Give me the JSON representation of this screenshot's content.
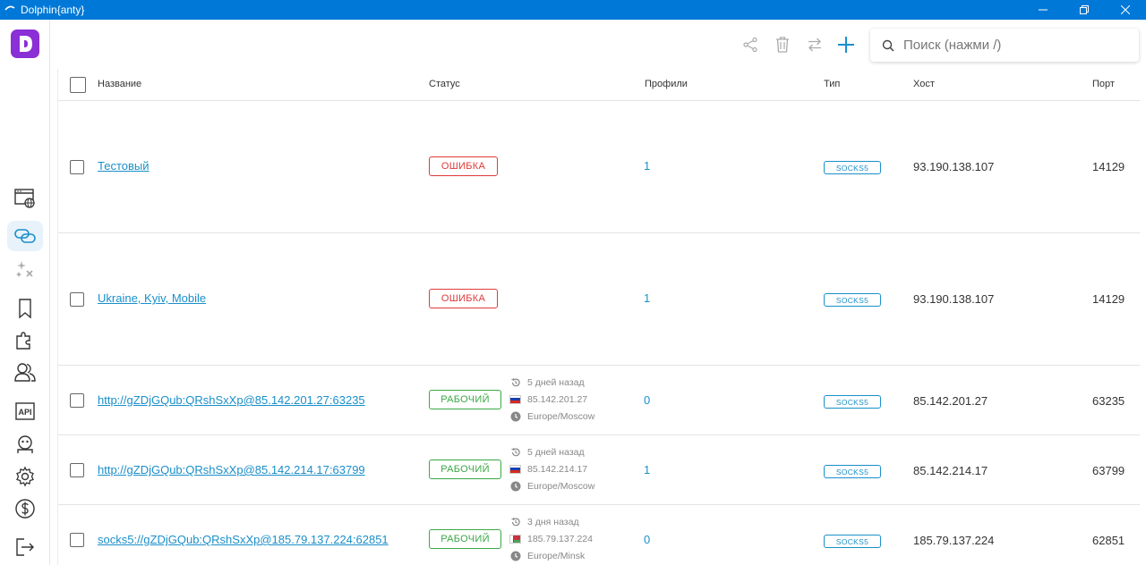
{
  "window": {
    "title": "Dolphin{anty}"
  },
  "search": {
    "placeholder": "Поиск (нажми /)"
  },
  "table": {
    "headers": {
      "name": "Название",
      "status": "Статус",
      "profiles": "Профили",
      "type": "Тип",
      "host": "Хост",
      "port": "Порт"
    },
    "rows": [
      {
        "name": "Тестовый",
        "status": "ОШИБКА",
        "profiles": "1",
        "type": "SOCKS5",
        "host": "93.190.138.107",
        "port": "14129"
      },
      {
        "name": "Ukraine, Kyiv, Mobile",
        "status": "ОШИБКА",
        "profiles": "1",
        "type": "SOCKS5",
        "host": "93.190.138.107",
        "port": "14129"
      },
      {
        "name": "http://gZDjGQub:QRshSxXp@85.142.201.27:63235",
        "status": "РАБОЧИЙ",
        "checked": "5 дней назад",
        "ip": "85.142.201.27",
        "timezone": "Europe/Moscow",
        "flag": "russia",
        "profiles": "0",
        "type": "SOCKS5",
        "host": "85.142.201.27",
        "port": "63235"
      },
      {
        "name": "http://gZDjGQub:QRshSxXp@85.142.214.17:63799",
        "status": "РАБОЧИЙ",
        "checked": "5 дней назад",
        "ip": "85.142.214.17",
        "timezone": "Europe/Moscow",
        "flag": "russia",
        "profiles": "1",
        "type": "SOCKS5",
        "host": "85.142.214.17",
        "port": "63799"
      },
      {
        "name": "socks5://gZDjGQub:QRshSxXp@185.79.137.224:62851",
        "status": "РАБОЧИЙ",
        "checked": "3 дня назад",
        "ip": "185.79.137.224",
        "timezone": "Europe/Minsk",
        "flag": "belarus",
        "profiles": "0",
        "type": "SOCKS5",
        "host": "185.79.137.224",
        "port": "62851"
      }
    ]
  },
  "colors": {
    "accent": "#1a8fc9",
    "error": "#e03a3a",
    "ok": "#3aa845",
    "titlebar": "#0078d7",
    "logo": "#8b2fd6"
  },
  "icons": [
    "browser-globe-icon",
    "proxy-link-icon",
    "sparkle-automation-icon",
    "bookmark-icon",
    "extensions-puzzle-icon",
    "users-icon",
    "api-icon",
    "robot-icon",
    "gear-icon",
    "dollar-icon",
    "logout-icon",
    "share-icon",
    "trash-icon",
    "swap-icon",
    "plus-icon",
    "search-icon"
  ]
}
